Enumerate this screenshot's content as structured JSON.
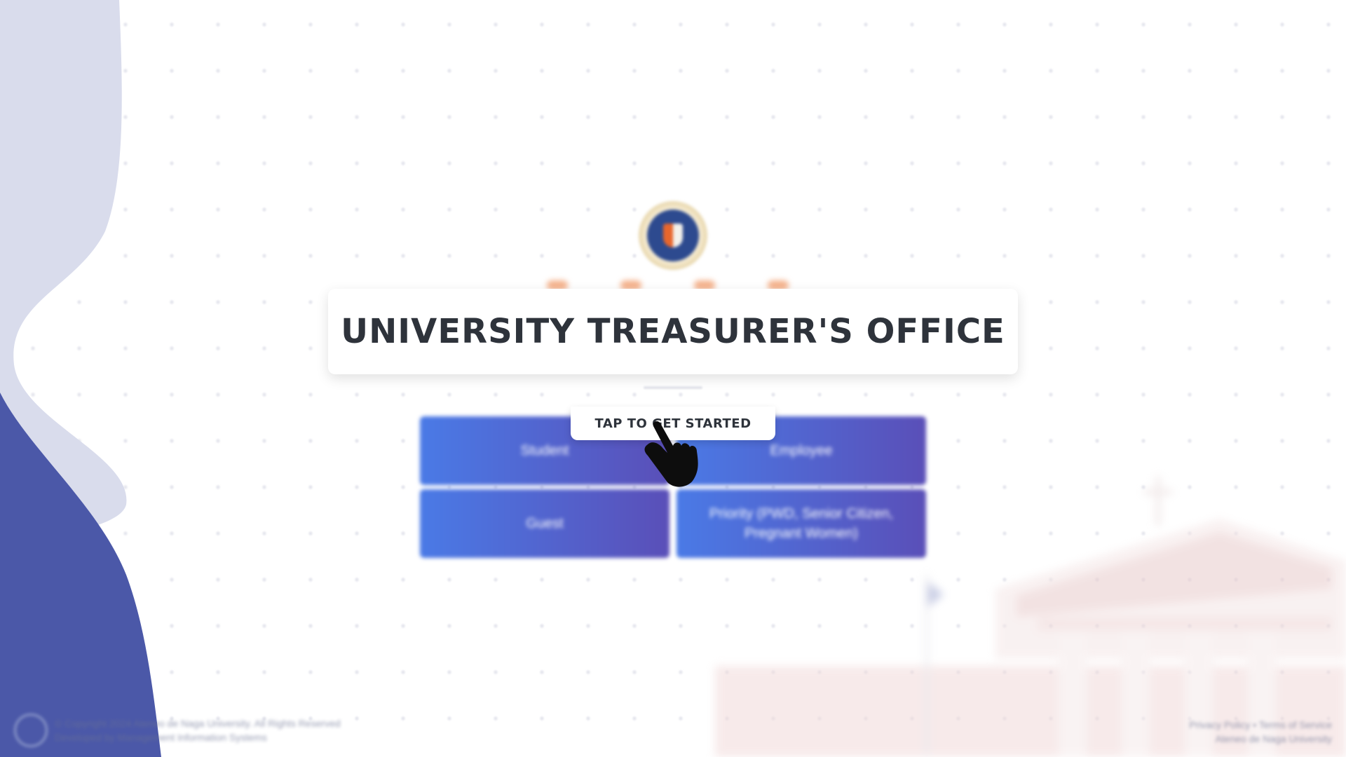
{
  "header": {
    "title": "UNIVERSITY TREASURER'S OFFICE",
    "cta_label": "TAP TO GET STARTED"
  },
  "options": [
    {
      "label": "Student"
    },
    {
      "label": "Employee"
    },
    {
      "label": "Guest"
    },
    {
      "label": "Priority (PWD, Senior Citizen, Pregnant Women)"
    }
  ],
  "footer": {
    "left_line1": "© Copyright 2024 Ateneo de Naga University. All Rights Reserved",
    "left_line2": "Developed by Management Information Systems",
    "right_line1": "Privacy Policy • Terms of Service",
    "right_line2": "Ateneo de Naga University"
  },
  "colors": {
    "accent_gradient_start": "#4a7ae6",
    "accent_gradient_end": "#5a4fb8",
    "wave_dark": "#4b58a8",
    "wave_light": "#d9dcec",
    "title_text": "#2e333b"
  },
  "icons": {
    "pointer": "hand-pointer-icon",
    "seal": "university-seal-icon",
    "footer_logo": "footer-logo-icon"
  }
}
